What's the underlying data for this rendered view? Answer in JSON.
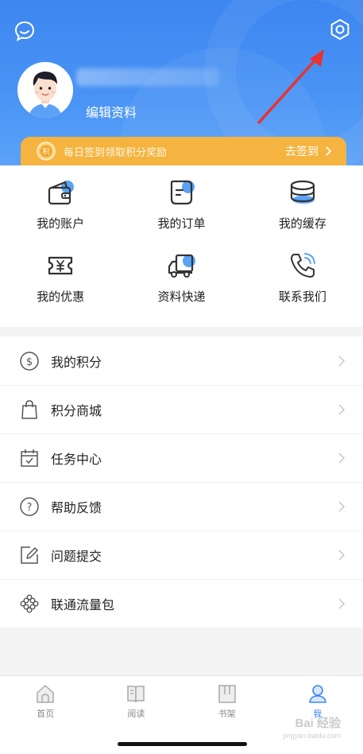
{
  "header": {
    "edit_profile": "编辑资料",
    "checkin_text": "每日签到领取积分奖励",
    "checkin_action": "去签到",
    "coin_glyph": "积"
  },
  "grid": [
    {
      "label": "我的账户",
      "icon": "wallet-icon"
    },
    {
      "label": "我的订单",
      "icon": "order-icon"
    },
    {
      "label": "我的缓存",
      "icon": "cache-icon"
    },
    {
      "label": "我的优惠",
      "icon": "coupon-icon"
    },
    {
      "label": "资料快递",
      "icon": "truck-icon"
    },
    {
      "label": "联系我们",
      "icon": "phone-icon"
    }
  ],
  "menu": [
    {
      "label": "我的积分",
      "icon": "points-icon"
    },
    {
      "label": "积分商城",
      "icon": "shopping-bag-icon"
    },
    {
      "label": "任务中心",
      "icon": "calendar-check-icon"
    },
    {
      "label": "帮助反馈",
      "icon": "help-icon"
    },
    {
      "label": "问题提交",
      "icon": "edit-icon"
    },
    {
      "label": "联通流量包",
      "icon": "unicom-knot-icon"
    }
  ],
  "tabs": [
    {
      "label": "首页",
      "icon": "home-icon"
    },
    {
      "label": "阅读",
      "icon": "book-icon"
    },
    {
      "label": "书架",
      "icon": "bookshelf-icon"
    },
    {
      "label": "我",
      "icon": "user-icon",
      "active": true
    }
  ],
  "watermark": {
    "main": "Bai 经验",
    "sub": "jingyan.baidu.com"
  },
  "colors": {
    "primary": "#3d86f0",
    "checkin_bar": "#f4b43f",
    "arrow": "#e8332f"
  }
}
